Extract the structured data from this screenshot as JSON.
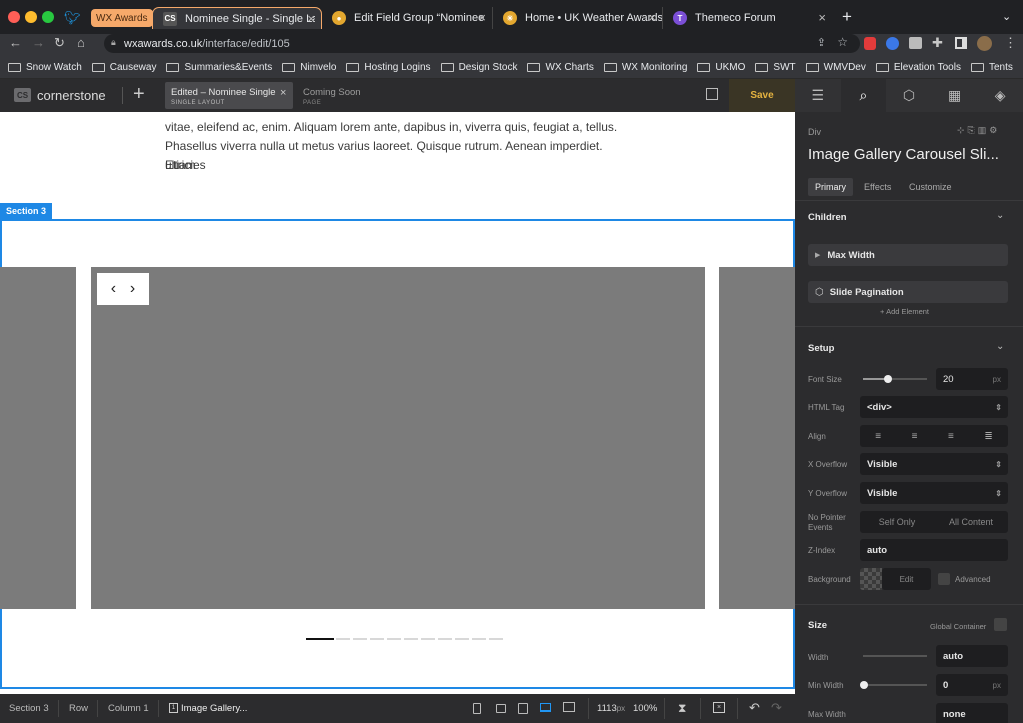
{
  "browser": {
    "tabs": [
      {
        "label": "WX Awards",
        "active": false,
        "pinned_group": true
      },
      {
        "label": "Nominee Single - Single Layout",
        "active": true
      },
      {
        "label": "Edit Field Group “Nominee Sub",
        "active": false
      },
      {
        "label": "Home • UK Weather Awards",
        "active": false
      },
      {
        "label": "Themeco Forum",
        "active": false
      }
    ],
    "url_host": "wxawards.co.uk",
    "url_path": "/interface/edit/105",
    "bookmarks": [
      "Snow Watch",
      "Causeway",
      "Summaries&Events",
      "Nimvelo",
      "Hosting Logins",
      "Design Stock",
      "WX Charts",
      "WX Monitoring",
      "UKMO",
      "SWT",
      "WMVDev",
      "Elevation Tools",
      "Tents"
    ]
  },
  "cornerstone": {
    "brand": "cornerstone",
    "tabs": [
      {
        "title": "Edited – Nominee Single",
        "subtitle": "SINGLE LAYOUT"
      },
      {
        "title": "Coming Soon",
        "subtitle": "PAGE"
      }
    ],
    "save_label": "Save"
  },
  "canvas": {
    "text_lines": [
      "vitae, eleifend ac, enim. Aliquam lorem ante, dapibus in, viverra quis, feugiat a, tellus.",
      "Phasellus viverra nulla ut metus varius laoreet. Quisque rutrum. Aenean imperdiet. Etiam",
      "ultricies"
    ],
    "section_label": "Section 3",
    "pagination_count": 11,
    "pagination_active": 0
  },
  "inspector": {
    "element_type": "Div",
    "element_title": "Image Gallery Carousel Sli...",
    "tabs": [
      "Primary",
      "Effects",
      "Customize"
    ],
    "children_title": "Children",
    "children": [
      "Max Width",
      "Slide Pagination"
    ],
    "add_element": "Add Element",
    "setup_title": "Setup",
    "font_size_label": "Font Size",
    "font_size_value": "20",
    "font_size_unit": "px",
    "html_tag_label": "HTML Tag",
    "html_tag_value": "<div>",
    "align_label": "Align",
    "x_overflow_label": "X Overflow",
    "x_overflow_value": "Visible",
    "y_overflow_label": "Y Overflow",
    "y_overflow_value": "Visible",
    "no_pointer_label": "No Pointer Events",
    "self_only": "Self Only",
    "all_content": "All Content",
    "zindex_label": "Z-Index",
    "zindex_value": "auto",
    "background_label": "Background",
    "edit_label": "Edit",
    "advanced_label": "Advanced",
    "size_title": "Size",
    "global_container": "Global Container",
    "width_label": "Width",
    "width_value": "auto",
    "min_width_label": "Min Width",
    "min_width_value": "0",
    "min_width_unit": "px",
    "max_width_label": "Max Width",
    "max_width_value": "none"
  },
  "breadcrumbs": [
    "Section 3",
    "Row",
    "Column 1",
    "Image Gallery..."
  ],
  "viewport": {
    "width": "1113",
    "unit": "px",
    "zoom": "100%"
  }
}
